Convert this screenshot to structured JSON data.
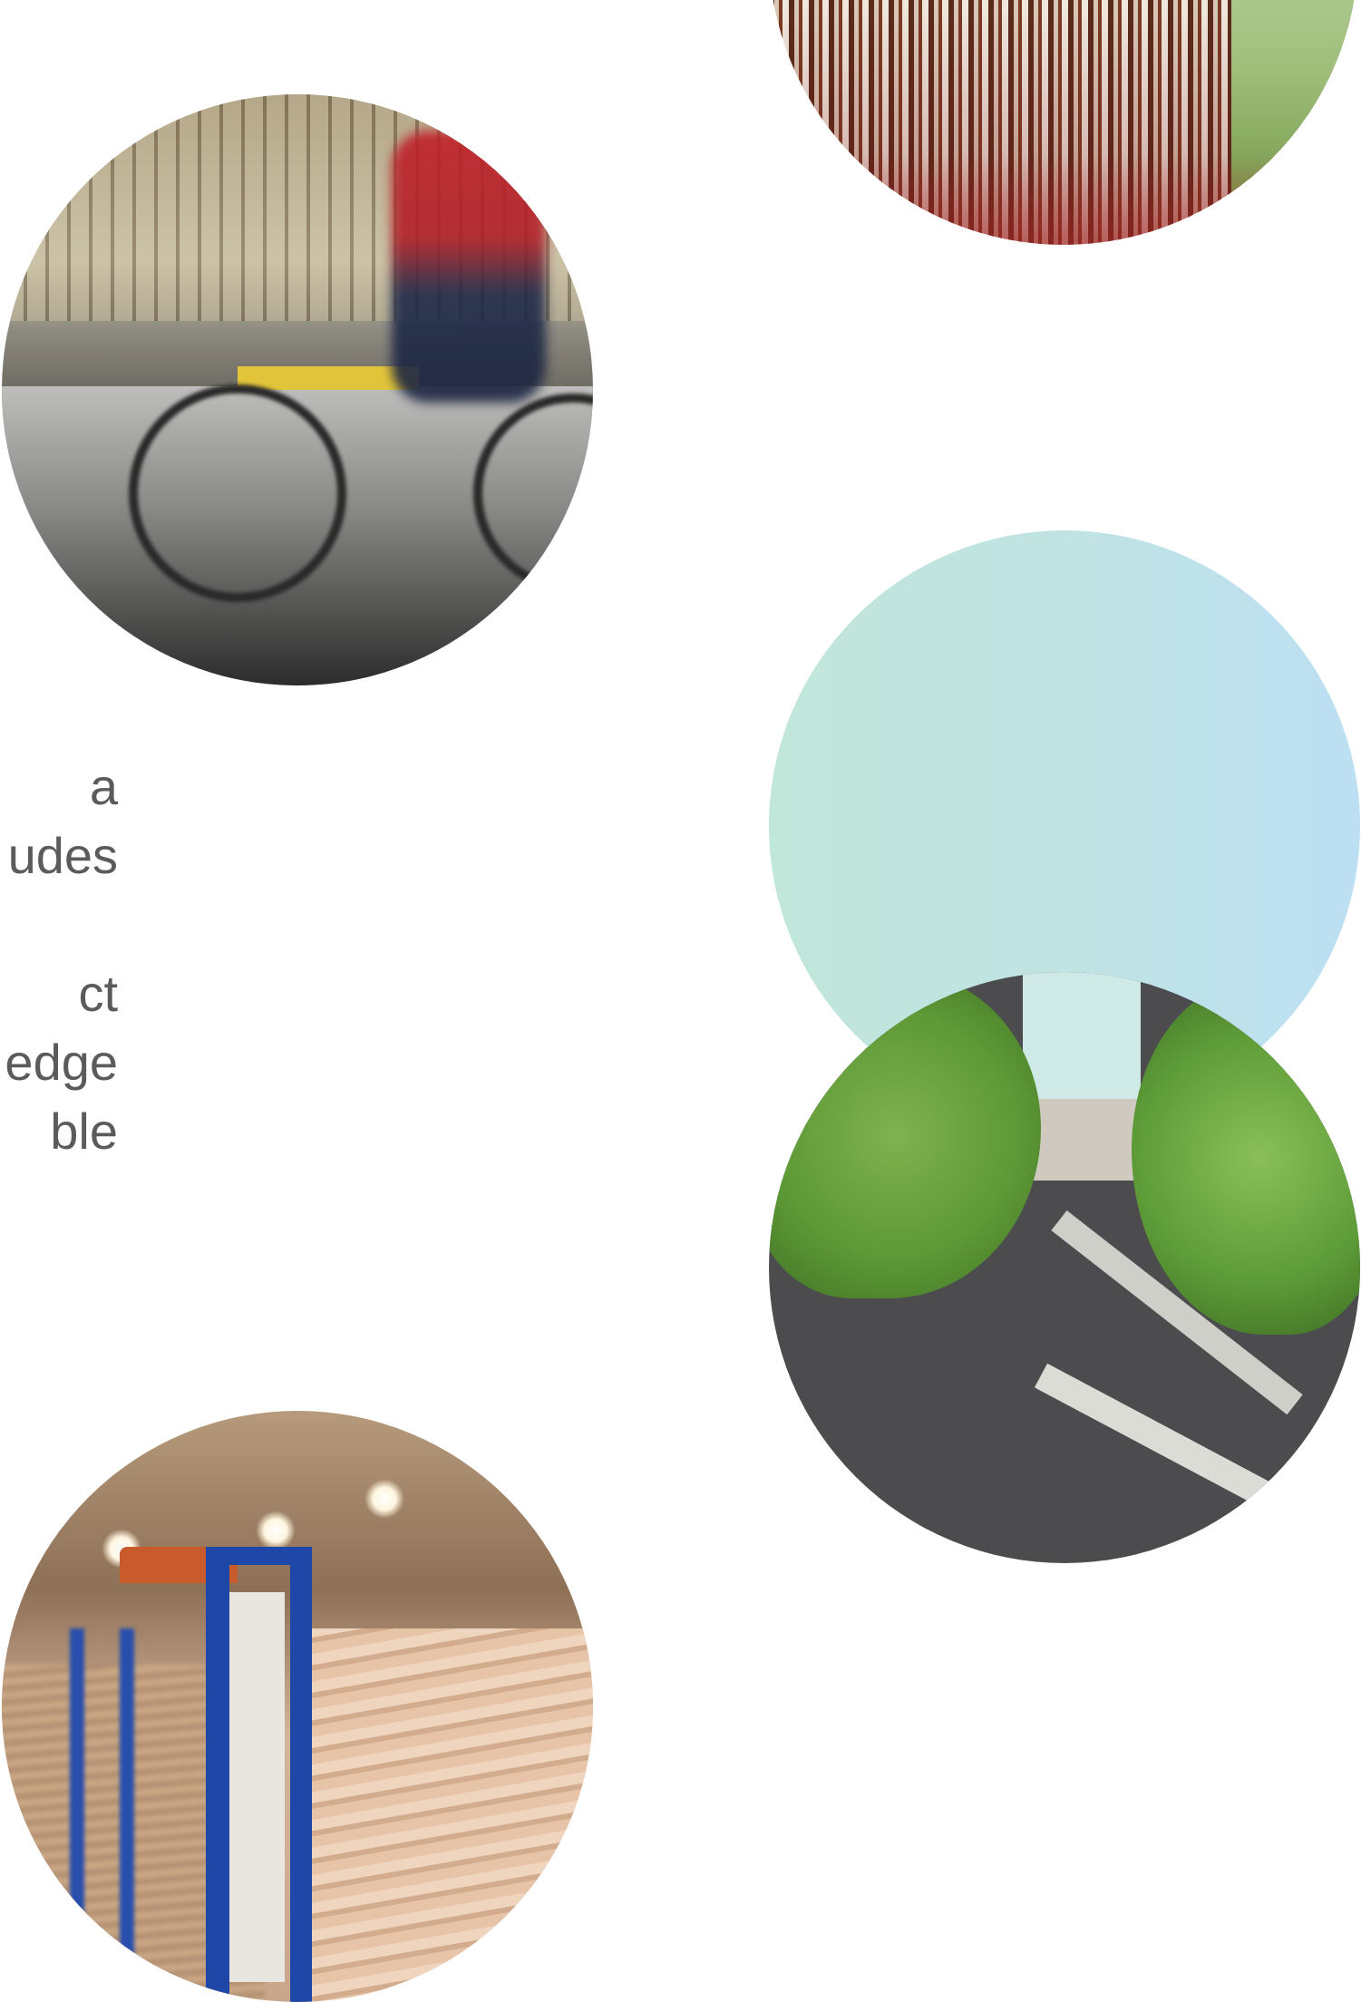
{
  "body_text": {
    "paragraph_1": [
      "a",
      "udes"
    ],
    "paragraph_2": [
      "ct",
      "edge",
      "ble"
    ]
  }
}
